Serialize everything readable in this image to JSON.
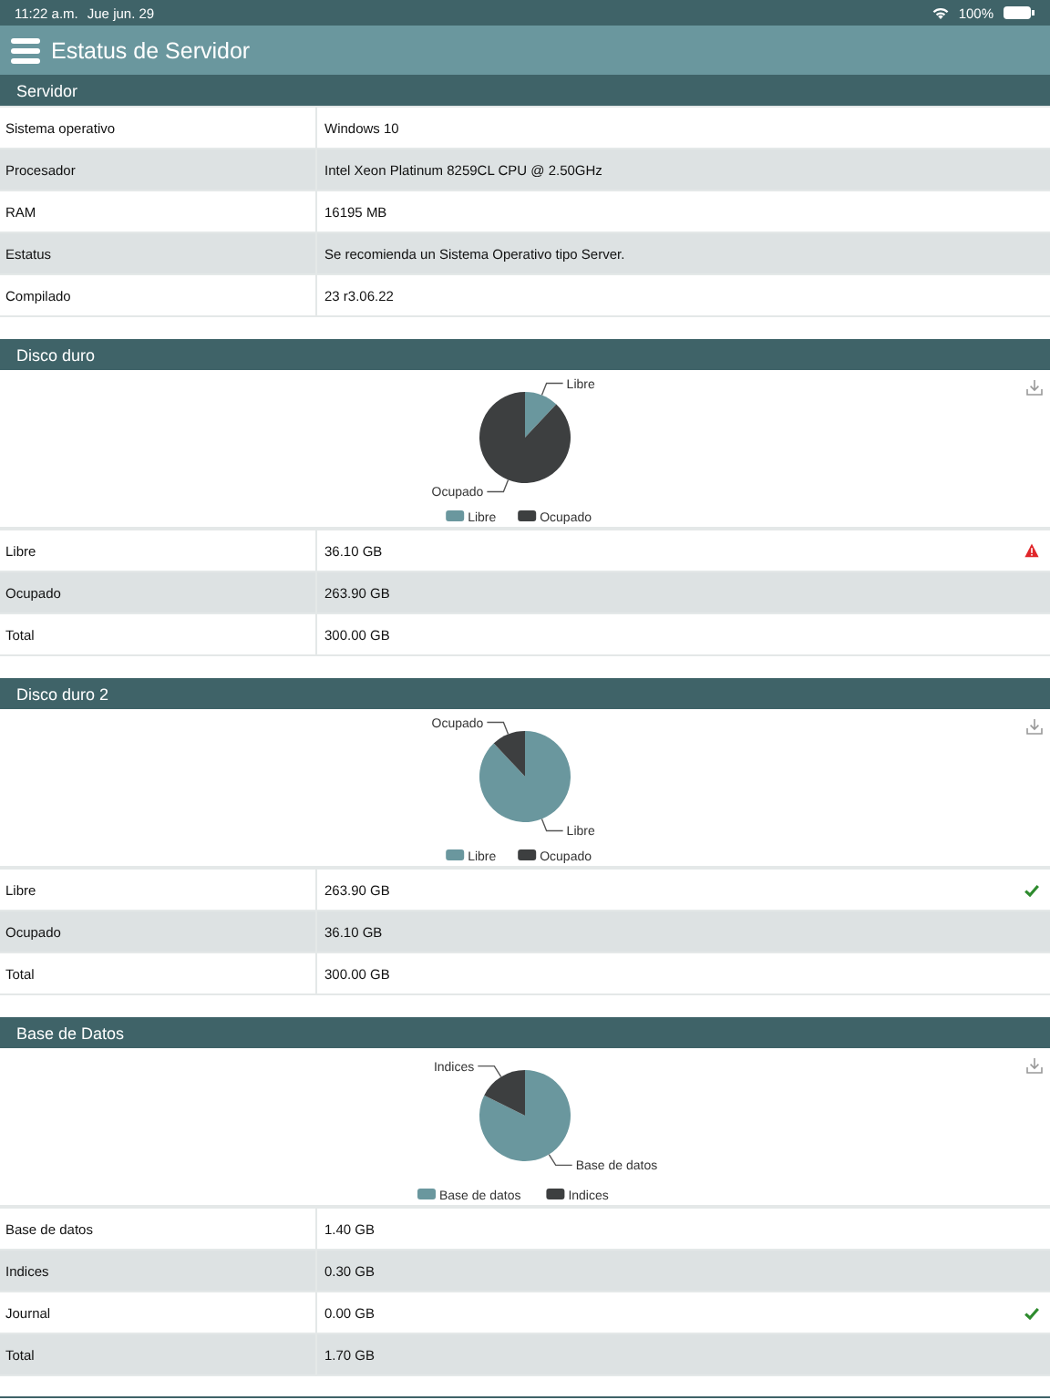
{
  "status_bar": {
    "time": "11:22 a.m.",
    "date": "Jue jun. 29",
    "battery": "100%"
  },
  "header": {
    "title": "Estatus de Servidor"
  },
  "sections": [
    {
      "title": "Servidor",
      "rows": [
        {
          "label": "Sistema operativo",
          "value": "Windows 10"
        },
        {
          "label": "Procesador",
          "value": "Intel Xeon Platinum 8259CL CPU @ 2.50GHz"
        },
        {
          "label": "RAM",
          "value": "16195 MB"
        },
        {
          "label": "Estatus",
          "value": "Se recomienda un Sistema Operativo tipo Server."
        },
        {
          "label": "Compilado",
          "value": "23 r3.06.22"
        }
      ]
    },
    {
      "title": "Disco duro",
      "chart_data": {
        "type": "pie",
        "categories": [
          "Libre",
          "Ocupado"
        ],
        "values": [
          12.03,
          87.97
        ],
        "colors": [
          "#6a979e",
          "#3d3f40"
        ],
        "legend": "bottom"
      },
      "rows": [
        {
          "kind": "warning",
          "label": "Libre",
          "value": "36.10 GB"
        },
        {
          "kind": "plain",
          "label": "Ocupado",
          "value": "263.90 GB"
        },
        {
          "kind": "plain",
          "label": "Total",
          "value": "300.00 GB"
        }
      ]
    },
    {
      "title": "Disco duro 2",
      "chart_data": {
        "type": "pie",
        "categories": [
          "Libre",
          "Ocupado"
        ],
        "values": [
          87.97,
          12.03
        ],
        "colors": [
          "#6a979e",
          "#3d3f40"
        ],
        "legend": "bottom"
      },
      "rows": [
        {
          "kind": "ok",
          "label": "Libre",
          "value": "263.90 GB"
        },
        {
          "kind": "plain",
          "label": "Ocupado",
          "value": "36.10 GB"
        },
        {
          "kind": "plain",
          "label": "Total",
          "value": "300.00 GB"
        }
      ]
    },
    {
      "title": "Base de Datos",
      "chart_data": {
        "type": "pie",
        "categories": [
          "Base de datos",
          "Indices"
        ],
        "values": [
          82.35,
          17.65
        ],
        "colors": [
          "#6a979e",
          "#3d3f40"
        ],
        "legend": "bottom"
      },
      "rows": [
        {
          "kind": "plain",
          "label": "Base de datos",
          "value": "1.40 GB"
        },
        {
          "kind": "plain",
          "label": "Indices",
          "value": "0.30 GB"
        },
        {
          "kind": "ok",
          "label": "Journal",
          "value": "0.00 GB"
        },
        {
          "kind": "plain",
          "label": "Total",
          "value": "1.70 GB"
        }
      ]
    }
  ]
}
